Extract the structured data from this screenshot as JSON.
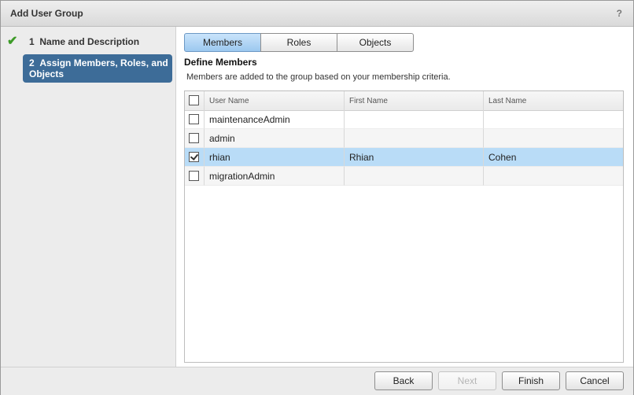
{
  "dialog": {
    "title": "Add User Group",
    "help": "?"
  },
  "steps": [
    {
      "number": "1",
      "label": "Name and Description",
      "done": true
    },
    {
      "number": "2",
      "label": "Assign Members, Roles, and Objects",
      "current": true
    }
  ],
  "tabs": [
    {
      "label": "Members",
      "active": true
    },
    {
      "label": "Roles"
    },
    {
      "label": "Objects"
    }
  ],
  "section": {
    "title": "Define Members",
    "description": "Members are added to the group based on your membership criteria."
  },
  "table": {
    "columns": [
      "User Name",
      "First Name",
      "Last Name"
    ],
    "rows": [
      {
        "user": "maintenanceAdmin",
        "first": "",
        "last": "",
        "checked": false
      },
      {
        "user": "admin",
        "first": "",
        "last": "",
        "checked": false
      },
      {
        "user": "rhian",
        "first": "Rhian",
        "last": "Cohen",
        "checked": true
      },
      {
        "user": "migrationAdmin",
        "first": "",
        "last": "",
        "checked": false
      }
    ]
  },
  "footer": {
    "back": "Back",
    "next": "Next",
    "finish": "Finish",
    "cancel": "Cancel"
  },
  "colors": {
    "accent": "#3d6c98",
    "selected_row": "#b9dcf7",
    "check": "#3d9b28"
  }
}
